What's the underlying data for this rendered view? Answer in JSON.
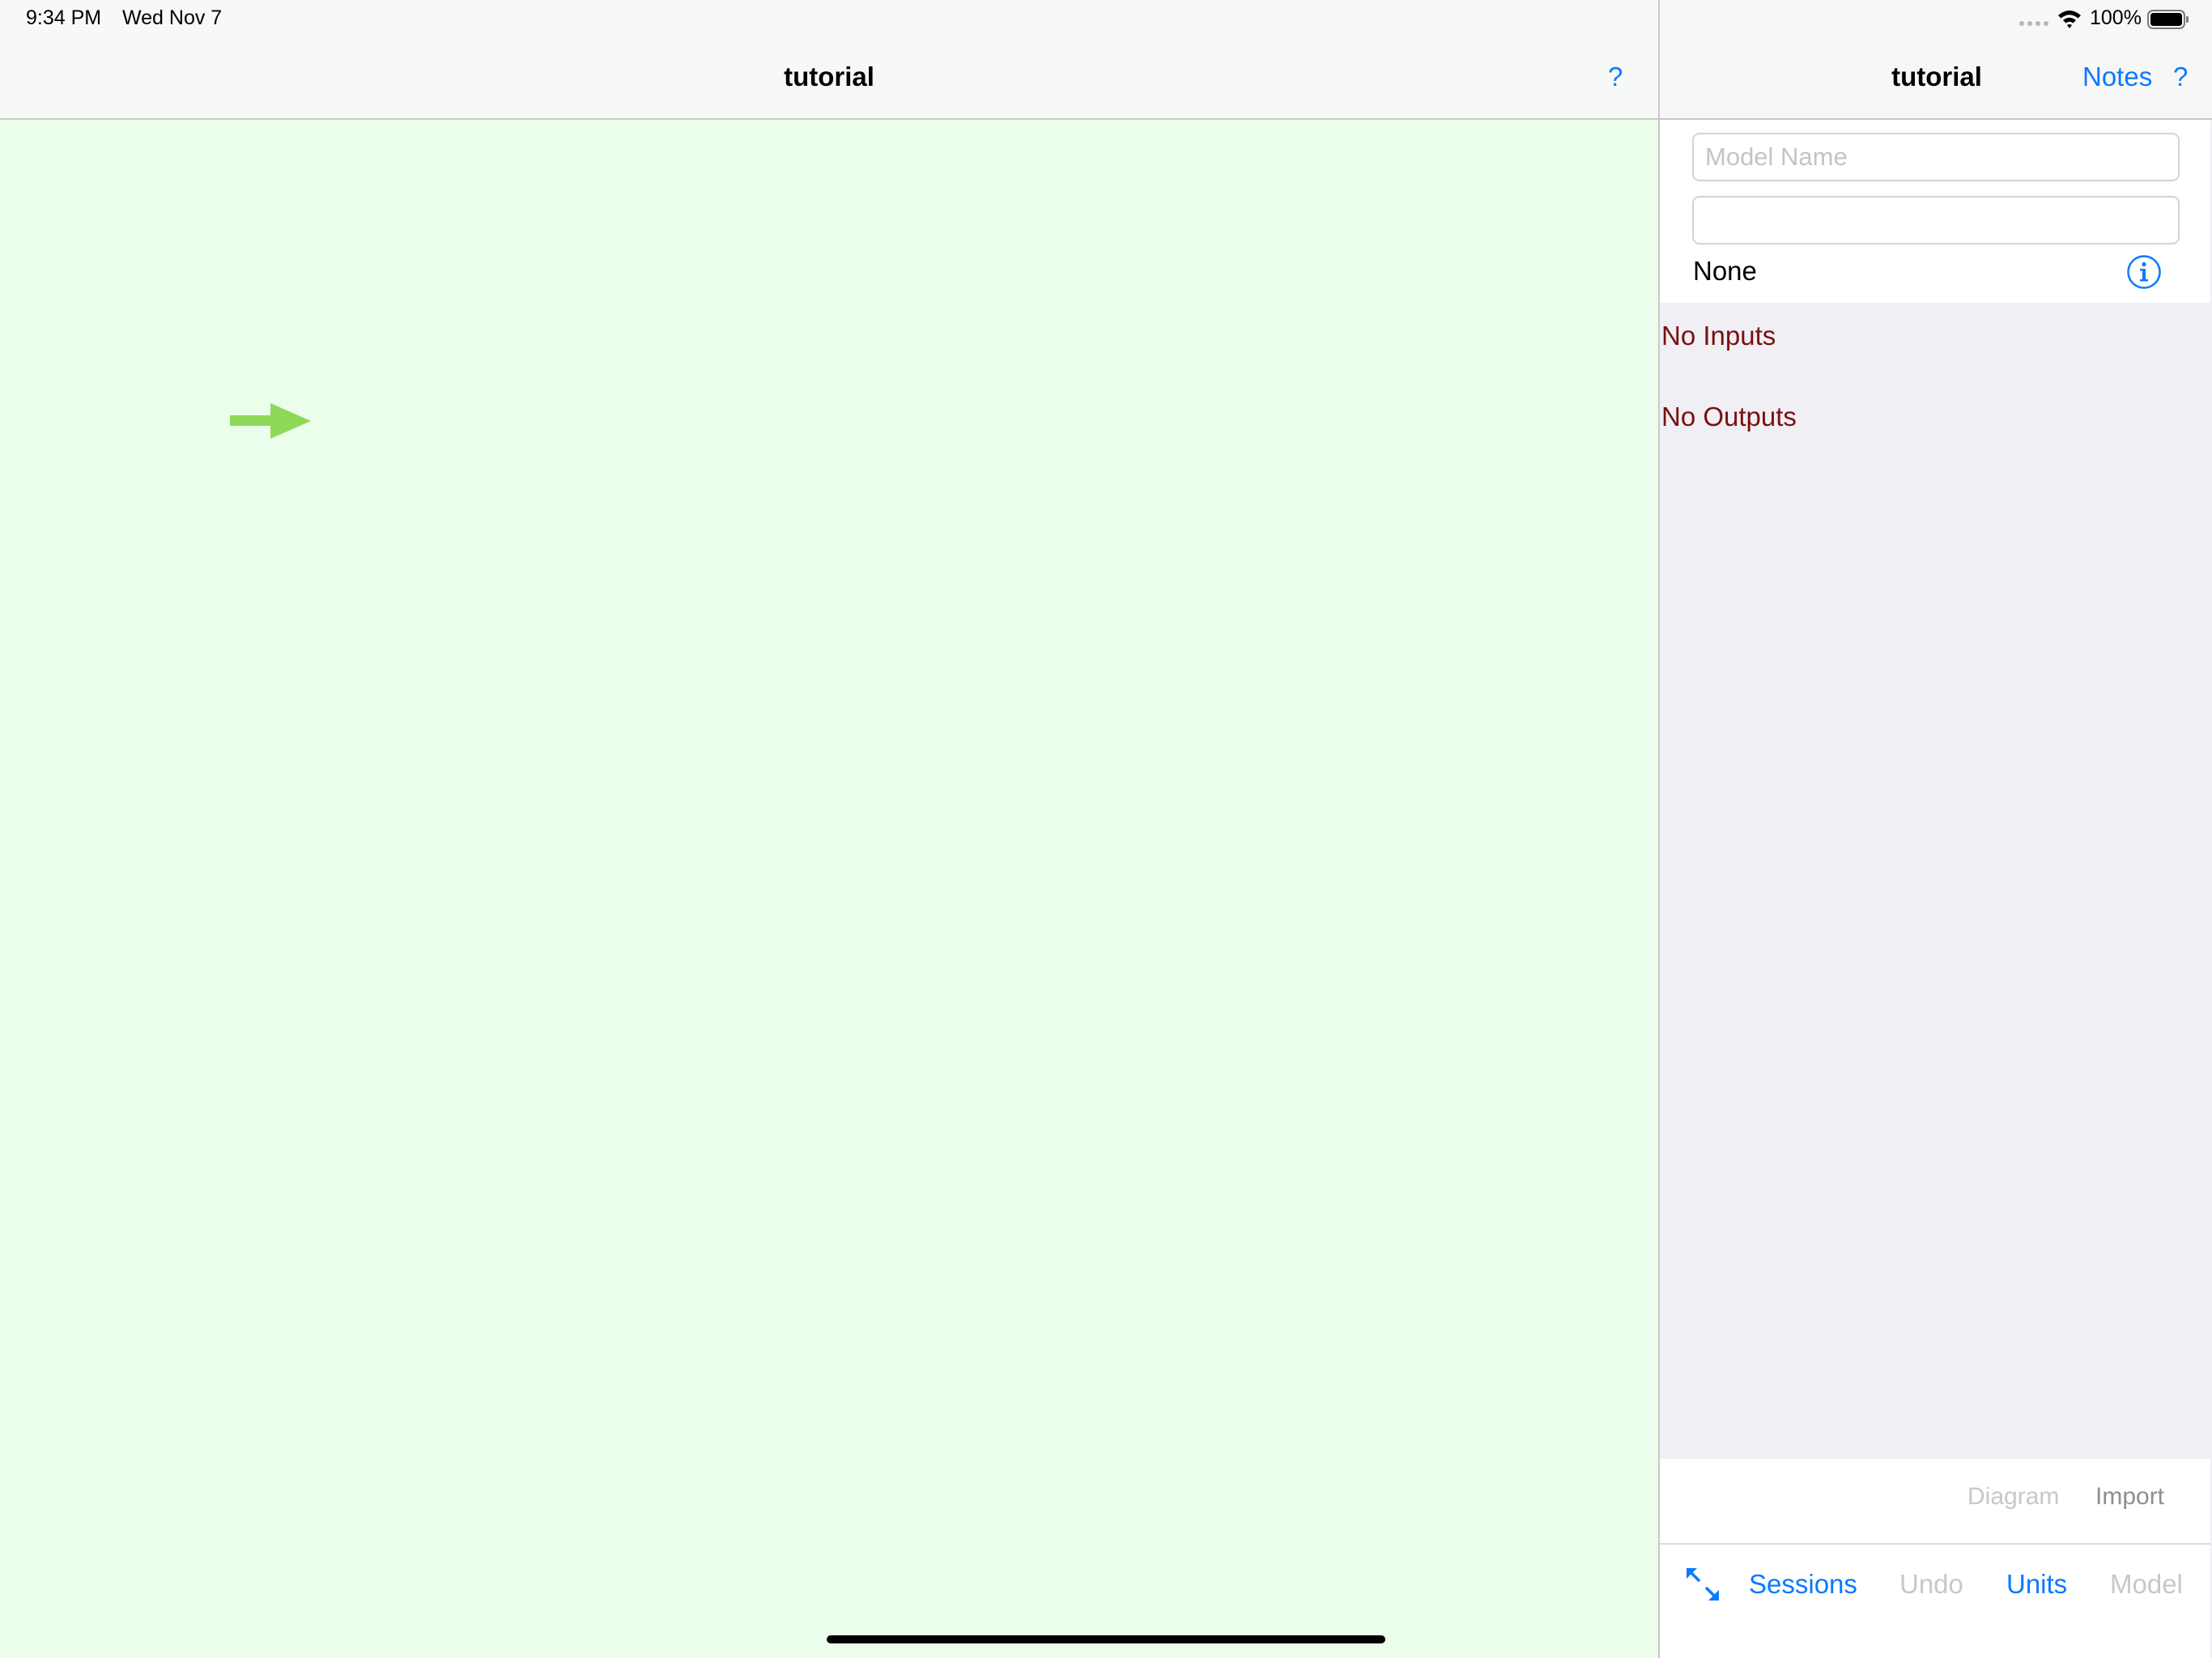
{
  "status_bar": {
    "time": "9:34 PM",
    "date": "Wed Nov 7",
    "battery": "100%",
    "icons": [
      "signal-dots-icon",
      "wifi-icon",
      "battery-icon"
    ]
  },
  "left_nav": {
    "title": "tutorial",
    "help_label": "?"
  },
  "canvas": {
    "arrow_icon": "right-arrow-icon",
    "arrow_color": "#8fd85a",
    "background_color": "#ebfdeb"
  },
  "right_nav": {
    "title": "tutorial",
    "notes_label": "Notes",
    "help_label": "?"
  },
  "form": {
    "model_name_value": "",
    "model_name_placeholder": "Model Name",
    "second_value": "",
    "type_value": "None",
    "info_icon": "info-icon"
  },
  "lists": {
    "no_inputs": "No Inputs",
    "no_outputs": "No Outputs",
    "empty_color": "#7a1010"
  },
  "actions": {
    "diagram_label": "Diagram",
    "import_label": "Import"
  },
  "toolbar": {
    "expand_icon": "expand-icon",
    "sessions_label": "Sessions",
    "undo_label": "Undo",
    "units_label": "Units",
    "model_label": "Model"
  },
  "colors": {
    "accent": "#0a7aff",
    "disabled": "#c7c7cc"
  }
}
